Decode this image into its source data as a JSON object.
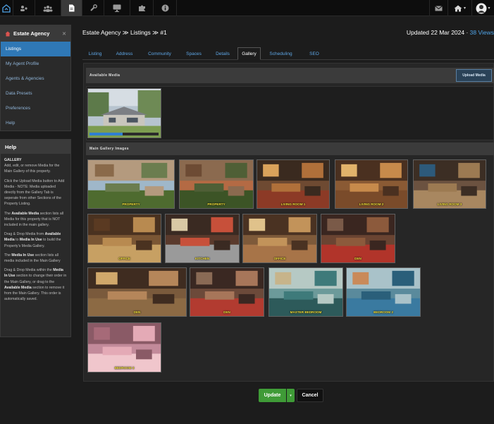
{
  "topbar": {
    "icons": [
      "logo-icon",
      "users-group-icon",
      "people-icon",
      "document-icon",
      "wrench-icon",
      "monitor-icon",
      "puzzle-icon",
      "info-icon"
    ],
    "right_icons": [
      "mail-icon",
      "home-icon",
      "avatar"
    ],
    "caret": "▾"
  },
  "sidebar": {
    "title": "Estate Agency",
    "items": [
      {
        "label": "Listings",
        "active": true
      },
      {
        "label": "My Agent Profile"
      },
      {
        "label": "Agents & Agencies"
      },
      {
        "label": "Data Presets"
      },
      {
        "label": "Preferences"
      },
      {
        "label": "Help"
      }
    ]
  },
  "help": {
    "title": "Help",
    "heading": "GALLERY",
    "p1": "Add, edit, or remove Media for the Main Gallery of this property.",
    "p2": "Click the Upload Media button to Add Media - NOTE: Media uploaded directly from the Gallery Tab is seperate from other Sections of the Property Listing.",
    "p3a": "The ",
    "p3b": "Available Media",
    "p3c": " section lists all Media for this property that is NOT included in the main gallery.",
    "p4a": "Drag & Drop Media from ",
    "p4b": "Available Media",
    "p4c": " to ",
    "p4d": "Media In Use",
    "p4e": " to build the Property's Media Gallery.",
    "p5a": "The ",
    "p5b": "Media In Use",
    "p5c": " section lists all media included in the Main Gallery",
    "p6a": "Drag & Drop Media within the ",
    "p6b": "Media In Use",
    "p6c": " section to change their order in the Main Gallery, or drag to the ",
    "p6d": "Available Media",
    "p6e": " section to remove it from the Main Gallery. This order is automatically saved."
  },
  "header": {
    "breadcrumb": "Estate Agency ≫ Listings ≫ #1",
    "updated": "Updated 22 Mar 2024 · ",
    "views": "38 Views"
  },
  "tabs": [
    "Listing",
    "Address",
    "Community",
    "Spaces",
    "Details",
    "Gallery",
    "Scheduling",
    "SEO"
  ],
  "active_tab": "Gallery",
  "available": {
    "title": "Available Media",
    "upload_label": "Upload Media",
    "upload_progress": 0.48
  },
  "main_gallery": {
    "title": "Main Gallery Images",
    "images": [
      {
        "caption": "PROPERTY",
        "scene": "exterior"
      },
      {
        "caption": "PROPERTY",
        "scene": "exterior-dusk"
      },
      {
        "caption": "LIVING ROOM 1",
        "scene": "living"
      },
      {
        "caption": "LIVING ROOM 2",
        "scene": "living2"
      },
      {
        "caption": "LIVING ROOM 3",
        "scene": "stairs"
      },
      {
        "caption": "OFFICE",
        "scene": "office"
      },
      {
        "caption": "KITCHEN",
        "scene": "kitchen"
      },
      {
        "caption": "OFFICE",
        "scene": "office2"
      },
      {
        "caption": "DEN",
        "scene": "den"
      },
      {
        "caption": "DEN",
        "scene": "den2"
      },
      {
        "caption": "DEN",
        "scene": "den3"
      },
      {
        "caption": "MASTER BEDROOM",
        "scene": "bedroom"
      },
      {
        "caption": "BEDROOM 2",
        "scene": "bedroom2"
      },
      {
        "caption": "BEDROOM 3",
        "scene": "bedroom3"
      }
    ]
  },
  "footer": {
    "update_label": "Update",
    "cancel_label": "Cancel"
  }
}
